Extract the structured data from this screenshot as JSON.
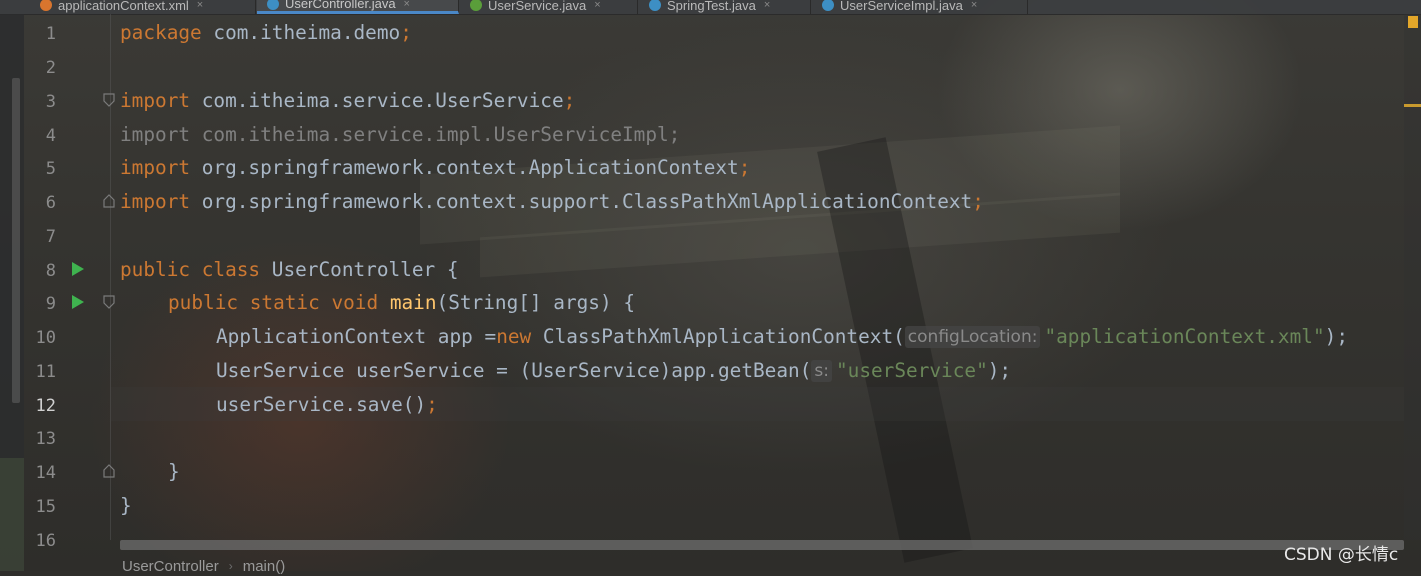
{
  "tabs": [
    {
      "label": "applicationContext.xml",
      "icon": "xml-file-icon",
      "color": "#d9752e"
    },
    {
      "label": "UserController.java",
      "icon": "java-class-icon",
      "color": "#3d8fc4",
      "active": true
    },
    {
      "label": "UserService.java",
      "icon": "java-interface-icon",
      "color": "#5a9e3a"
    },
    {
      "label": "SpringTest.java",
      "icon": "java-class-icon",
      "color": "#3d8fc4"
    },
    {
      "label": "UserServiceImpl.java",
      "icon": "java-class-icon",
      "color": "#3d8fc4"
    }
  ],
  "tab_close_glyph": "×",
  "line_numbers": [
    "1",
    "2",
    "3",
    "4",
    "5",
    "6",
    "7",
    "8",
    "9",
    "10",
    "11",
    "12",
    "13",
    "14",
    "15",
    "16"
  ],
  "current_line": "12",
  "code": {
    "l1": {
      "kw": "package",
      "pkg": " com.itheima.demo",
      "semi": ";"
    },
    "l3": {
      "kw": "import",
      "text": " com.itheima.service.UserService",
      "semi": ";"
    },
    "l4": {
      "text": "import com.itheima.service.impl.UserServiceImpl;"
    },
    "l5": {
      "kw": "import",
      "text": " org.springframework.context.ApplicationContext",
      "semi": ";"
    },
    "l6": {
      "kw": "import",
      "text": " org.springframework.context.support.ClassPathXmlApplicationContext",
      "semi": ";"
    },
    "l8": {
      "kw": "public class",
      "text": " UserController {"
    },
    "l9": {
      "kw": "public static void",
      "fn": "main",
      "text": "(String[] args) {"
    },
    "l10": {
      "text": "ApplicationContext app =",
      "kw": "new",
      "text2": " ClassPathXmlApplicationContext(",
      "hint": "configLocation:",
      "str": "\"applicationContext.xml\"",
      "end": ");"
    },
    "l11": {
      "text": "UserService userService = (UserService)app.getBean(",
      "hint": "s:",
      "str": "\"userService\"",
      "end": ");"
    },
    "l12": {
      "text": "userService.save()",
      "semi": ";"
    },
    "l14": {
      "text": "}"
    },
    "l15": {
      "text": "}"
    }
  },
  "breadcrumb": {
    "first": "UserController",
    "sep": "›",
    "second": "main()"
  },
  "watermark": "CSDN @长情c",
  "colors": {
    "keyword": "#cc7832",
    "string": "#6a8759",
    "method": "#ffc66d",
    "text": "#a9b7c6",
    "run": "#3fb34f",
    "active_tab_border": "#4a88c7"
  }
}
